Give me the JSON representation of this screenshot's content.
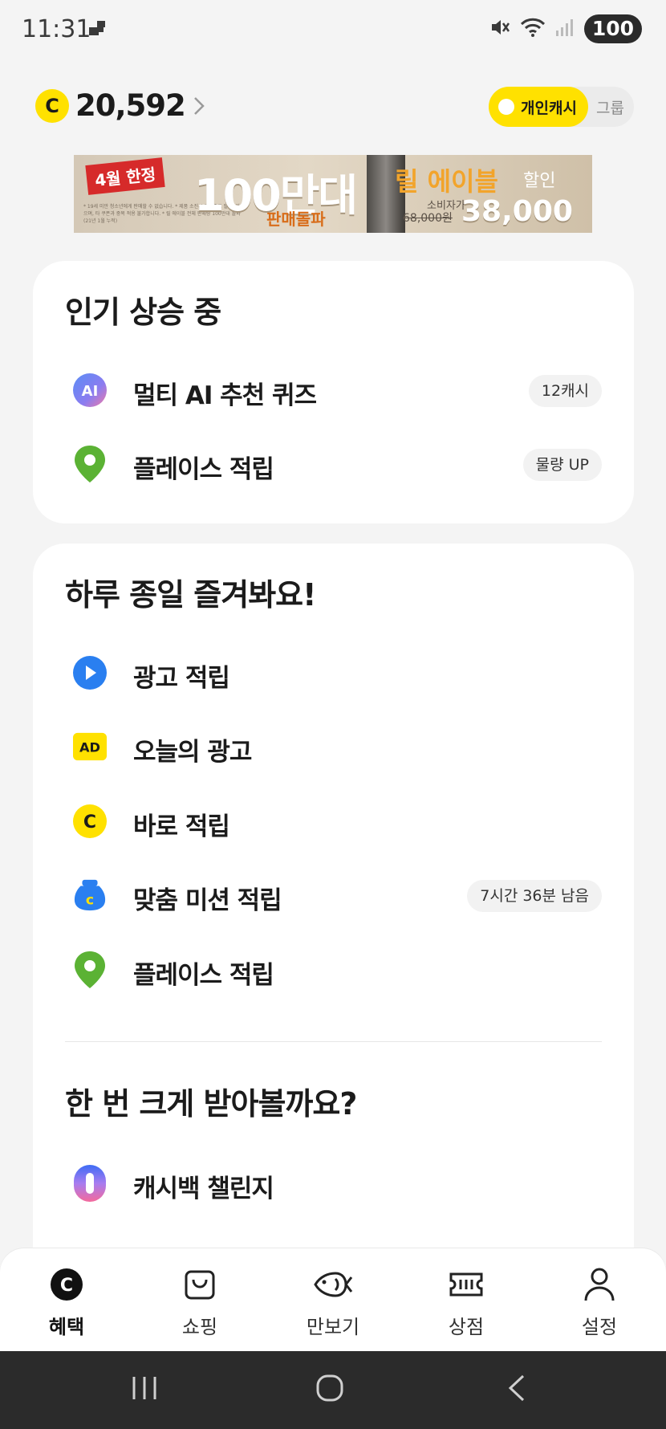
{
  "status_bar": {
    "time": "11:31",
    "battery": "100"
  },
  "header": {
    "coin_symbol": "C",
    "cash_amount": "20,592",
    "toggle_active": "개인캐시",
    "toggle_inactive": "그룹"
  },
  "banner": {
    "tag": "4월 한정",
    "headline": "100만대",
    "sub": "판매돌파",
    "brand": "릴 에이블",
    "sale": "할인",
    "orig_label": "소비자가",
    "orig_price": "68,000원",
    "price": "38,000원",
    "fine_print": "* 19세 미만 청소년에게 판매할 수 없습니다. * 제품 소진시 조기종료 될 수 있으며, 타 쿠폰과 중복 적용 불가합니다. * 릴 에이블 전체 판매량 100만대 돌파(21년 1월 누적)"
  },
  "popular": {
    "title": "인기 상승 중",
    "items": [
      {
        "label": "멀티 AI 추천 퀴즈",
        "badge": "12캐시",
        "icon": "ai-icon"
      },
      {
        "label": "플레이스 적립",
        "badge": "물량 UP",
        "icon": "map-pin-icon"
      }
    ]
  },
  "daily": {
    "title": "하루 종일 즐겨봐요!",
    "items": [
      {
        "label": "광고 적립",
        "icon": "play-icon"
      },
      {
        "label": "오늘의 광고",
        "icon": "ad-icon",
        "icon_text": "AD"
      },
      {
        "label": "바로 적립",
        "icon": "coin-icon",
        "icon_text": "C"
      },
      {
        "label": "맞춤 미션 적립",
        "badge": "7시간 36분 남음",
        "icon": "pouch-icon"
      },
      {
        "label": "플레이스 적립",
        "icon": "map-pin-icon"
      }
    ]
  },
  "big": {
    "title": "한 번 크게 받아볼까요?",
    "items": [
      {
        "label": "캐시백 챌린지",
        "icon": "capsule-icon"
      }
    ]
  },
  "bottom_nav": {
    "items": [
      {
        "label": "혜택",
        "icon": "benefit-icon",
        "active": true
      },
      {
        "label": "쇼핑",
        "icon": "shopping-bag-icon"
      },
      {
        "label": "만보기",
        "icon": "fish-icon"
      },
      {
        "label": "상점",
        "icon": "ticket-icon"
      },
      {
        "label": "설정",
        "icon": "user-icon"
      }
    ]
  },
  "colors": {
    "brand_yellow": "#ffe100",
    "background": "#f4f4f4",
    "text": "#1b1b1b",
    "place_green": "#5bb234",
    "play_blue": "#2a7ff0"
  }
}
